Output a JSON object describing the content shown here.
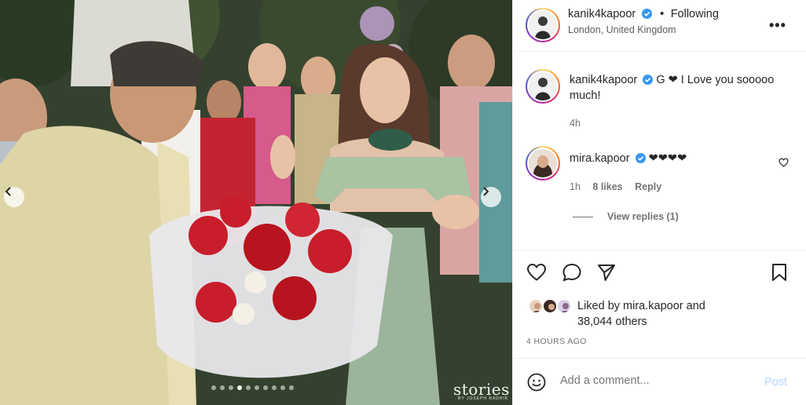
{
  "post": {
    "author": "kanik4kapoor",
    "separator": "•",
    "follow_status": "Following",
    "location": "London, United Kingdom",
    "more_icon": "more-horizontal-icon"
  },
  "photo": {
    "watermark": "stories",
    "watermark_sub": "BY JOSEPH RADHIK",
    "carousel_total": 10,
    "carousel_active": 3
  },
  "comments": [
    {
      "username": "kanik4kapoor",
      "text": "G ❤ I Love you sooooo much!",
      "time": "4h"
    },
    {
      "username": "mira.kapoor",
      "text": "❤❤❤❤",
      "time": "1h",
      "likes": "8 likes",
      "reply_label": "Reply",
      "view_replies": "View replies (1)"
    }
  ],
  "likes": {
    "prefix": "Liked by",
    "user": "mira.kapoor",
    "connector": "and",
    "others": "38,044 others"
  },
  "timestamp": "4 HOURS AGO",
  "composer": {
    "placeholder": "Add a comment...",
    "post_label": "Post"
  },
  "colors": {
    "verified": "#3897f0",
    "link_disabled": "#b3d7fb"
  }
}
